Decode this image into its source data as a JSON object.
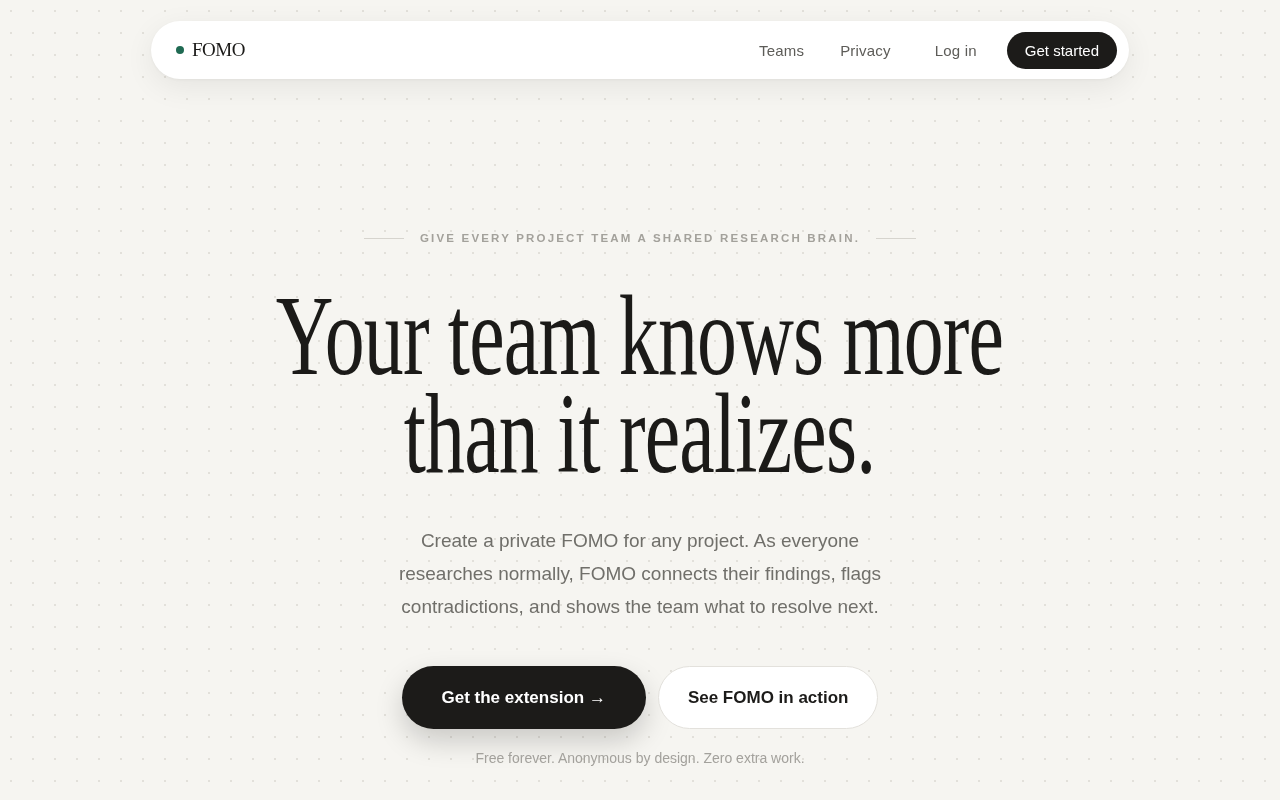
{
  "nav": {
    "logo": "FOMO",
    "links": [
      {
        "label": "Teams"
      },
      {
        "label": "Privacy"
      },
      {
        "label": "Log in"
      }
    ],
    "cta": "Get started"
  },
  "hero": {
    "eyebrow": "GIVE EVERY PROJECT TEAM A SHARED RESEARCH BRAIN.",
    "headline": [
      "Your team knows more",
      "than it realizes."
    ],
    "description": "Create a private FOMO for any project. As everyone researches normally, FOMO connects their findings, flags contradictions, and shows the team what to resolve next.",
    "buttons": [
      {
        "label": "Get the extension →",
        "kind": "primary"
      },
      {
        "label": "See FOMO in action",
        "kind": "secondary"
      }
    ],
    "note": "Free forever. Anonymous by design. Zero extra work."
  }
}
